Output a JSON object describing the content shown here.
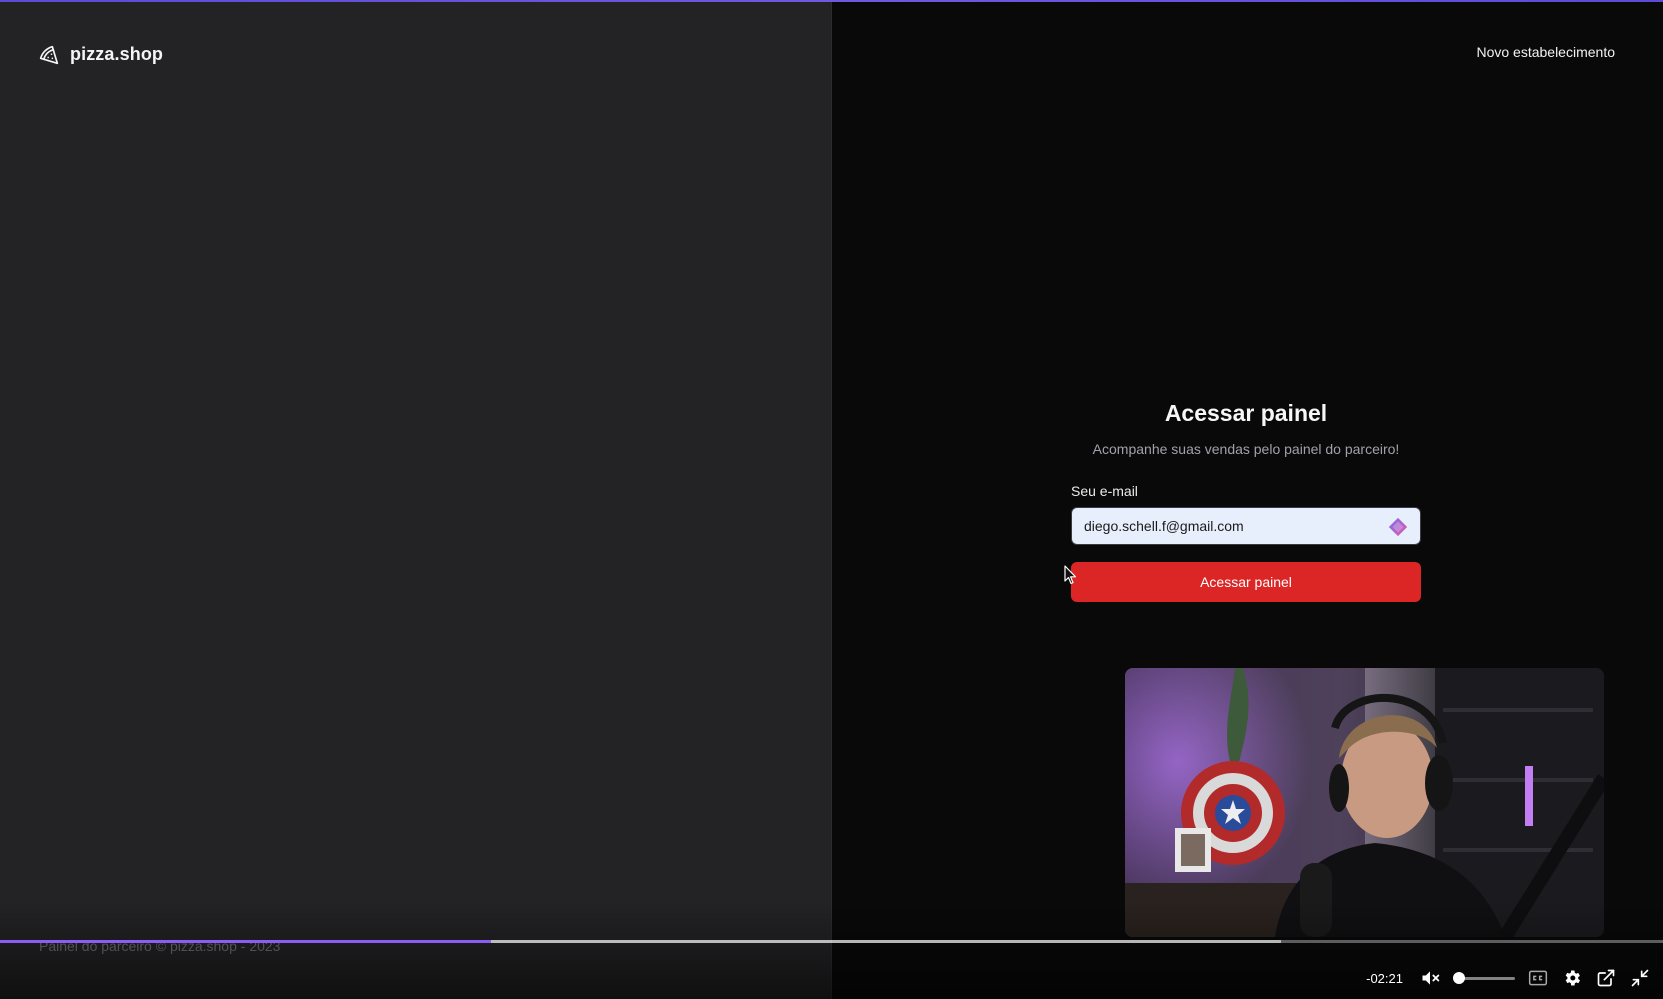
{
  "header": {
    "brand_name": "pizza.shop",
    "new_store_link": "Novo estabelecimento"
  },
  "footer": {
    "text": "Painel do parceiro © pizza.shop - 2023"
  },
  "login": {
    "title": "Acessar painel",
    "subtitle": "Acompanhe suas vendas pelo painel do parceiro!",
    "email_label": "Seu e-mail",
    "email_value": "diego.schell.f@gmail.com",
    "submit_label": "Acessar painel"
  },
  "player": {
    "time_remaining": "-02:21",
    "progress_fraction": 0.295,
    "buffered_fraction": 0.77,
    "volume_fraction": 0.0,
    "muted": true,
    "accent_color": "#8b5cf6"
  },
  "colors": {
    "button": "#dc2626",
    "left_bg": "#232325",
    "right_bg": "#09090a"
  },
  "icons": {
    "brand": "pizza-icon",
    "autofill": "autofill-icon",
    "mute": "volume-muted-icon",
    "captions": "captions-icon",
    "settings": "gear-icon",
    "popout": "popout-icon",
    "exit_fullscreen": "exit-fullscreen-icon"
  }
}
